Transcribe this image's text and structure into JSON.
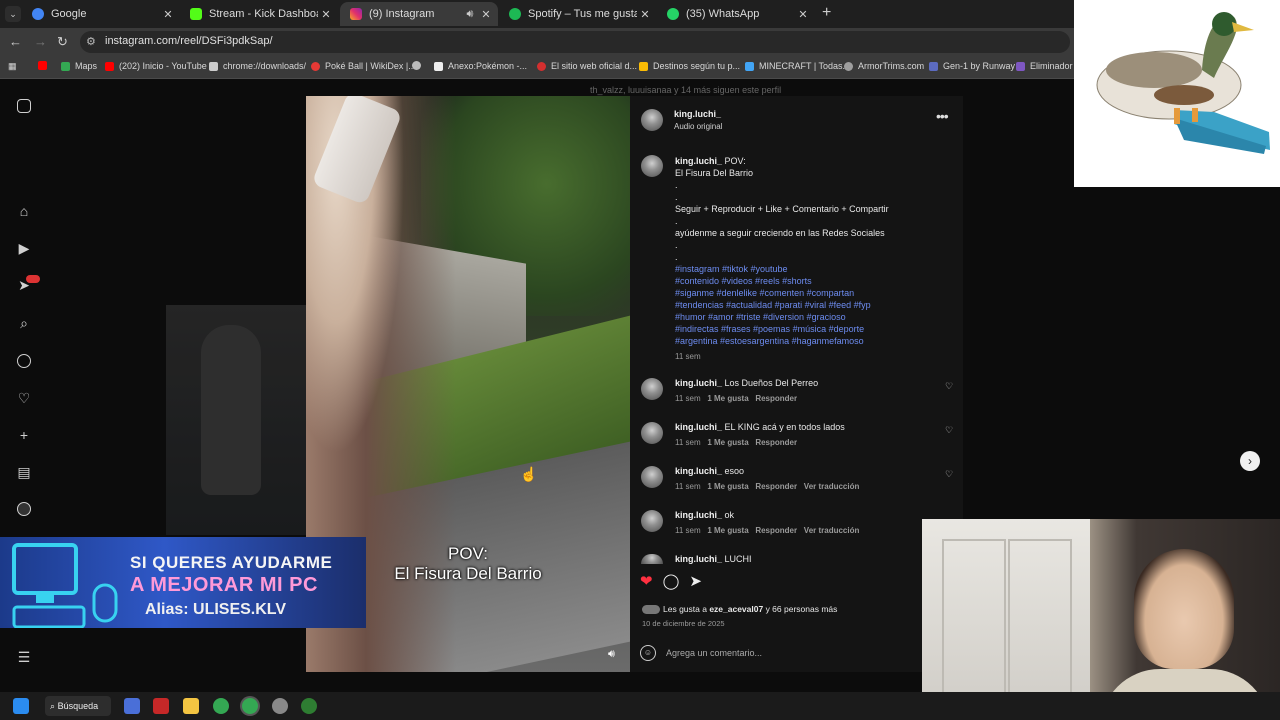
{
  "tabs": [
    {
      "title": "Google",
      "color": "#4285f4",
      "active": false
    },
    {
      "title": "Stream - Kick Dashboard",
      "color": "#53fc18",
      "active": false
    },
    {
      "title": "(9) Instagram",
      "color": "#e1306c",
      "active": true
    },
    {
      "title": "Spotify – Tus me gusta",
      "color": "#1db954",
      "active": false
    },
    {
      "title": "(35) WhatsApp",
      "color": "#25d366",
      "active": false
    }
  ],
  "url": "instagram.com/reel/DSFi3pdkSap/",
  "bookmarks": [
    {
      "label": "",
      "color": "#ff0000"
    },
    {
      "label": "Maps",
      "color": "#34a853"
    },
    {
      "label": "(202) Inicio - YouTube",
      "color": "#ff0000"
    },
    {
      "label": "chrome://downloads/",
      "color": "#cccccc"
    },
    {
      "label": "Poké Ball | WikiDex |...",
      "color": "#e53935"
    },
    {
      "label": "",
      "color": "#bbbbbb"
    },
    {
      "label": "Anexo:Pokémon -...",
      "color": "#eeeeee"
    },
    {
      "label": "El sitio web oficial d...",
      "color": "#d32f2f"
    },
    {
      "label": "Destinos según tu p...",
      "color": "#fbbc05"
    },
    {
      "label": "MINECRAFT | Todas...",
      "color": "#42a5f5"
    },
    {
      "label": "ArmorTrims.com",
      "color": "#9e9e9e"
    },
    {
      "label": "Gen-1 by Runway",
      "color": "#5c6bc0"
    },
    {
      "label": "Eliminador d",
      "color": "#7e57c2"
    }
  ],
  "followers_line": "th_valzz, luuuisanaa y 14 más siguen este perfil",
  "post": {
    "username": "king.luchi_",
    "audio": "Audio original",
    "caption_user": "king.luchi_",
    "caption_first": "POV:",
    "caption_second": "El Fisura Del Barrio",
    "dot": ".",
    "cta": "Seguir + Reproducir + Like + Comentario + Compartir",
    "help": "ayúdenme a seguir creciendo en las Redes Sociales",
    "hashtags": [
      "#instagram #tiktok #youtube",
      "#contenido #videos #reels #shorts",
      "#siganme #denlelike #comenten #compartan",
      "#tendencias #actualidad #parati #viral #feed #fyp",
      "#humor #amor #triste #diversion #gracioso",
      "#indirectas #frases #poemas #música #deporte",
      "#argentina #estoesargentina #haganmefamoso"
    ],
    "time": "11 sem"
  },
  "comments": [
    {
      "user": "king.luchi_",
      "text": "Los Dueños Del Perreo",
      "time": "11 sem",
      "likes": "1 Me gusta",
      "reply": "Responder",
      "translate": ""
    },
    {
      "user": "king.luchi_",
      "text": "EL KING acá y en todos lados",
      "time": "11 sem",
      "likes": "1 Me gusta",
      "reply": "Responder",
      "translate": ""
    },
    {
      "user": "king.luchi_",
      "text": "esoo",
      "time": "11 sem",
      "likes": "1 Me gusta",
      "reply": "Responder",
      "translate": "Ver traducción"
    },
    {
      "user": "king.luchi_",
      "text": "ok",
      "time": "11 sem",
      "likes": "1 Me gusta",
      "reply": "Responder",
      "translate": "Ver traducción"
    },
    {
      "user": "king.luchi_",
      "text": "LUCHI",
      "time": "",
      "likes": "",
      "reply": "",
      "translate": ""
    }
  ],
  "likes_line": {
    "prefix": "Les gusta a ",
    "user": "eze_aceval07",
    "suffix": " y 66 personas más"
  },
  "date": "10 de diciembre de 2025",
  "add_comment": "Agrega un comentario...",
  "video_overlay": {
    "line1": "POV:",
    "line2": "El Fisura Del Barrio"
  },
  "banner": {
    "line1": "SI QUERES AYUDARME",
    "line2": "A MEJORAR MI PC",
    "line3": "Alias: ULISES.KLV"
  },
  "taskbar": {
    "search": "Búsqueda"
  },
  "icons": {
    "sidebar": [
      "instagram-icon",
      "home-icon",
      "reels-icon",
      "messages-icon",
      "search-icon",
      "explore-icon",
      "heart-icon",
      "create-icon",
      "dashboard-icon",
      "profile-icon",
      "more-icon"
    ]
  }
}
